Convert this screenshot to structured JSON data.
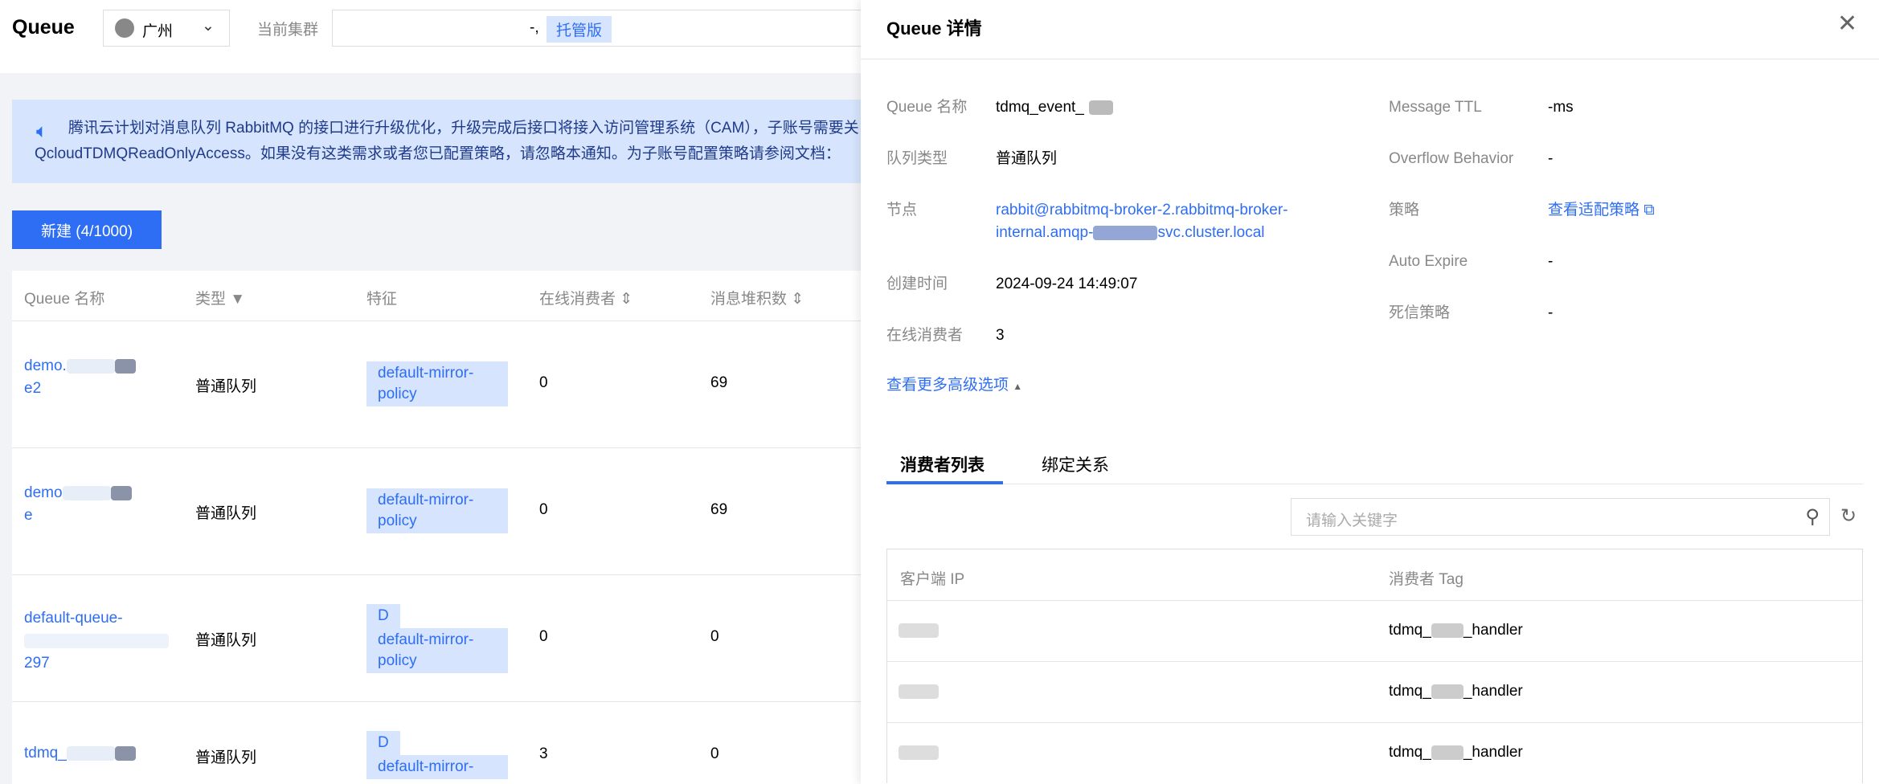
{
  "header": {
    "title": "Queue",
    "region": "广州",
    "cluster_label": "当前集群",
    "cluster_value": "-,",
    "cluster_badge": "托管版"
  },
  "banner": {
    "line1": "腾讯云计划对消息队列 RabbitMQ 的接口进行升级优化，升级完成后接口将接入访问管理系统（CAM），子账号需要关",
    "line2": "QcloudTDMQReadOnlyAccess。如果没有这类需求或者您已配置策略，请忽略本通知。为子账号配置策略请参阅文档："
  },
  "create_button": "新建 (4/1000)",
  "table": {
    "headers": [
      "Queue 名称",
      "类型",
      "特征",
      "在线消费者",
      "消息堆积数"
    ],
    "rows": [
      {
        "name1": "demo.",
        "name2": "e2",
        "type": "普通队列",
        "tags": [
          "default-mirror-policy"
        ],
        "consumers": "0",
        "backlog": "69"
      },
      {
        "name1": "demo",
        "name2": "e",
        "type": "普通队列",
        "tags": [
          "default-mirror-policy"
        ],
        "consumers": "0",
        "backlog": "69"
      },
      {
        "name1": "default-queue-",
        "name2": "297",
        "type": "普通队列",
        "tags": [
          "D",
          "default-mirror-policy"
        ],
        "consumers": "0",
        "backlog": "0"
      },
      {
        "name1": "tdmq_",
        "name2": "",
        "type": "普通队列",
        "tags": [
          "D",
          "default-mirror-"
        ],
        "consumers": "3",
        "backlog": "0"
      }
    ]
  },
  "drawer": {
    "title": "Queue 详情",
    "left": [
      {
        "label": "Queue 名称",
        "value": "tdmq_event_"
      },
      {
        "label": "队列类型",
        "value": "普通队列"
      },
      {
        "label": "节点",
        "value": "rabbit@rabbitmq-broker-2.rabbitmq-broker-",
        "value2": "internal.amqp-",
        "value3": "svc.cluster.local"
      },
      {
        "label": "创建时间",
        "value": "2024-09-24 14:49:07"
      },
      {
        "label": "在线消费者",
        "value": "3"
      }
    ],
    "right": [
      {
        "label": "Message TTL",
        "value": "-ms"
      },
      {
        "label": "Overflow Behavior",
        "value": "-"
      },
      {
        "label": "策略",
        "value": "查看适配策略"
      },
      {
        "label": "Auto Expire",
        "value": "-"
      },
      {
        "label": "死信策略",
        "value": "-"
      }
    ],
    "more_options": "查看更多高级选项",
    "tabs": [
      "消费者列表",
      "绑定关系"
    ],
    "search_placeholder": "请输入关键字",
    "consumer_headers": [
      "客户端 IP",
      "消费者 Tag"
    ],
    "consumers": [
      {
        "tag_a": "tdmq_",
        "tag_b": "_handler"
      },
      {
        "tag_a": "tdmq_",
        "tag_b": "_handler"
      },
      {
        "tag_a": "tdmq_",
        "tag_b": "_handler"
      }
    ]
  }
}
